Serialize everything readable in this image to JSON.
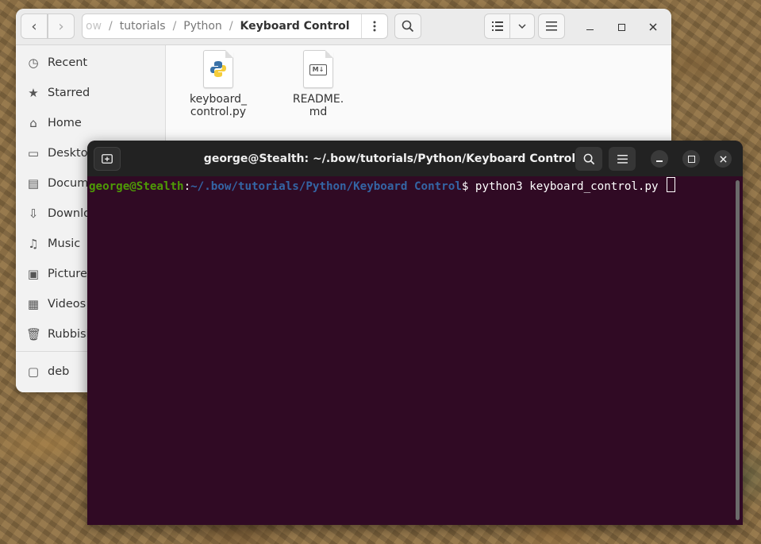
{
  "file_manager": {
    "path": {
      "partial": "ow",
      "segments": [
        "tutorials",
        "Python"
      ],
      "current": "Keyboard Control"
    },
    "sidebar": {
      "items": [
        {
          "label": "Recent",
          "icon": "clock-icon"
        },
        {
          "label": "Starred",
          "icon": "star-icon"
        },
        {
          "label": "Home",
          "icon": "home-icon"
        },
        {
          "label": "Desktop",
          "icon": "desktop-icon"
        },
        {
          "label": "Documents",
          "icon": "document-icon"
        },
        {
          "label": "Downloads",
          "icon": "download-icon"
        },
        {
          "label": "Music",
          "icon": "music-icon"
        },
        {
          "label": "Pictures",
          "icon": "picture-icon"
        },
        {
          "label": "Videos",
          "icon": "video-icon"
        },
        {
          "label": "Rubbish Bin",
          "icon": "trash-icon"
        }
      ],
      "devices": [
        {
          "label": "deb",
          "icon": "folder-icon"
        }
      ]
    },
    "files": [
      {
        "name_line1": "keyboard_",
        "name_line2": "control.py",
        "icon": "python-file-icon"
      },
      {
        "name_line1": "README.",
        "name_line2": "md",
        "icon": "markdown-file-icon"
      }
    ]
  },
  "terminal": {
    "title": "george@Stealth: ~/.bow/tutorials/Python/Keyboard Control",
    "prompt_user": "george@Stealth",
    "prompt_colon": ":",
    "prompt_path": "~/.bow/tutorials/Python/Keyboard Control",
    "prompt_symbol": "$ ",
    "command": "python3 keyboard_control.py"
  },
  "colors": {
    "terminal_bg": "#300a24",
    "prompt_user": "#4e9a06",
    "prompt_path": "#3465a4",
    "header_bg": "#222222"
  }
}
